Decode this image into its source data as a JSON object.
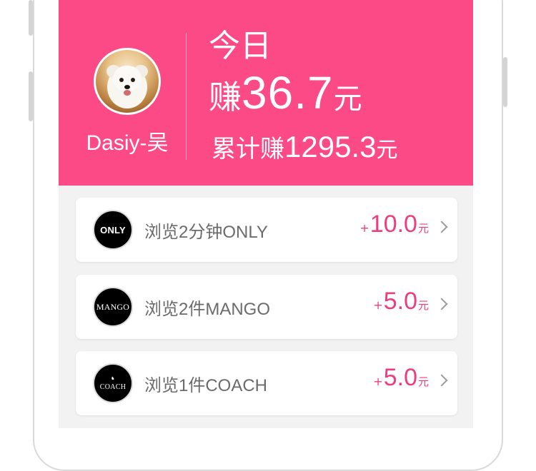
{
  "header": {
    "username": "Dasiy-吴",
    "today_label": "今日",
    "today_prefix": "赚",
    "today_amount": "36.7",
    "today_unit": "元",
    "total_prefix": "累计赚",
    "total_amount": "1295.3",
    "total_unit": "元"
  },
  "tasks": [
    {
      "brand": "ONLY",
      "label": "浏览2分钟ONLY",
      "plus": "+",
      "amount": "10.0",
      "unit": "元"
    },
    {
      "brand": "MANGO",
      "label": "浏览2件MANGO",
      "plus": "+",
      "amount": "5.0",
      "unit": "元"
    },
    {
      "brand": "COACH",
      "label": "浏览1件COACH",
      "plus": "+",
      "amount": "5.0",
      "unit": "元"
    }
  ],
  "colors": {
    "header_bg": "#fc4a87",
    "accent": "#ee3d7e",
    "page_bg": "#f2f2f2"
  },
  "icons": [
    "avatar-dog-photo",
    "only-logo",
    "mango-logo",
    "coach-logo",
    "chevron-right-icon"
  ]
}
